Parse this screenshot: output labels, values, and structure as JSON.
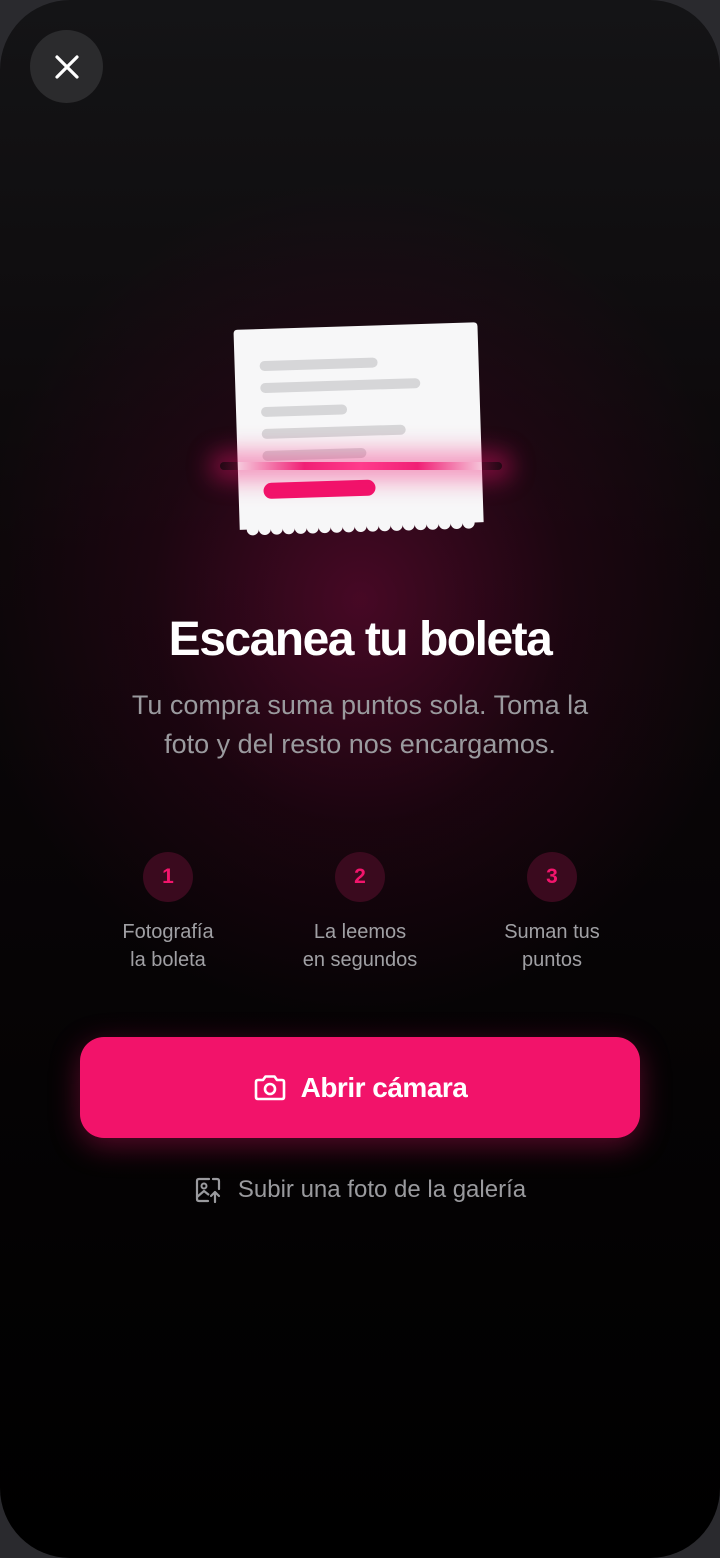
{
  "header": {
    "close_icon": "close-icon"
  },
  "hero": {
    "title": "Escanea tu boleta",
    "subtitle": "Tu compra suma puntos sola. Toma la foto y del resto nos encargamos."
  },
  "steps": [
    {
      "number": "1",
      "label": "Fotografía\nla boleta"
    },
    {
      "number": "2",
      "label": "La leemos\nen segundos"
    },
    {
      "number": "3",
      "label": "Suman tus\npuntos"
    }
  ],
  "actions": {
    "primary_label": "Abrir cámara",
    "primary_icon": "camera-icon",
    "secondary_label": "Subir una foto de la galería",
    "secondary_icon": "gallery-upload-icon"
  },
  "colors": {
    "accent": "#f2136a",
    "background": "#000000",
    "step_bg": "#3a0a1e"
  }
}
